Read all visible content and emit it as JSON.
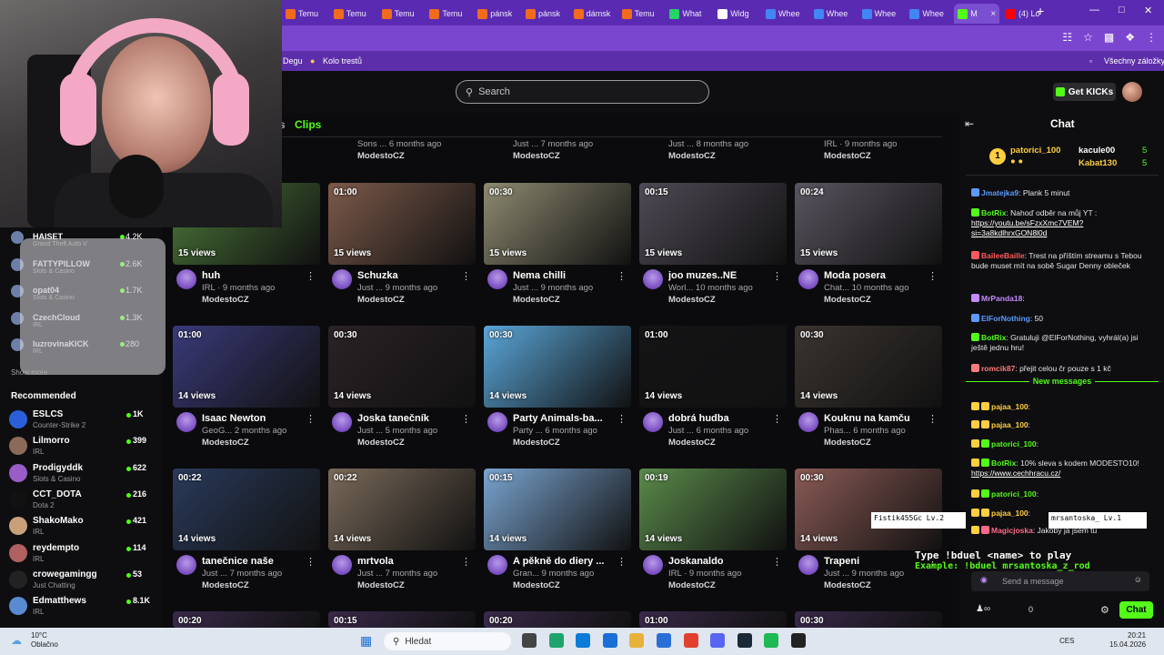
{
  "browser": {
    "tabs": [
      {
        "label": "Temu",
        "color": "#f26b1d"
      },
      {
        "label": "Temu",
        "color": "#f26b1d"
      },
      {
        "label": "Temu",
        "color": "#f26b1d"
      },
      {
        "label": "Temu",
        "color": "#f26b1d"
      },
      {
        "label": "pánsk",
        "color": "#f26b1d"
      },
      {
        "label": "pánsk",
        "color": "#f26b1d"
      },
      {
        "label": "dámsk",
        "color": "#f26b1d"
      },
      {
        "label": "Temu",
        "color": "#f26b1d"
      },
      {
        "label": "What",
        "color": "#25d366"
      },
      {
        "label": "Widg",
        "color": "#ffffff"
      },
      {
        "label": "Whee",
        "color": "#4285f4"
      },
      {
        "label": "Whee",
        "color": "#4285f4"
      },
      {
        "label": "Whee",
        "color": "#4285f4"
      },
      {
        "label": "Whee",
        "color": "#4285f4"
      },
      {
        "label": "M",
        "color": "#53fc18",
        "active": true
      },
      {
        "label": "(4) Lo",
        "color": "#ff0000"
      }
    ],
    "new_tab": "+",
    "bookmarks": [
      {
        "label": "Degu"
      },
      {
        "label": "Kolo trestů"
      }
    ],
    "all_bookmarks": "Všechny záložky"
  },
  "topnav": {
    "search_placeholder": "Search",
    "get_kicks": "Get KICKs"
  },
  "channel_tabs": {
    "prev_tab": "s",
    "active_tab": "Clips"
  },
  "following": [
    {
      "name": "HAISET",
      "sub": "Grand Theft Auto V",
      "count": "4.2K"
    },
    {
      "name": "FATTYPILLOW",
      "sub": "Slots & Casino",
      "count": "2.6K"
    },
    {
      "name": "opat04",
      "sub": "Slots & Casino",
      "count": "1.7K"
    },
    {
      "name": "CzechCloud",
      "sub": "IRL",
      "count": "1.3K"
    },
    {
      "name": "luzrovinaKICK",
      "sub": "IRL",
      "count": "280"
    }
  ],
  "show_more": "Show more",
  "recommended_title": "Recommended",
  "recommended": [
    {
      "name": "ESLCS",
      "category": "Counter-Strike 2",
      "count": "1K",
      "color": "#2b5fd9"
    },
    {
      "name": "Lilmorro",
      "category": "IRL",
      "count": "399",
      "color": "#8a6b5a"
    },
    {
      "name": "Prodigyddk",
      "category": "Slots & Casino",
      "count": "622",
      "color": "#9a5cc9"
    },
    {
      "name": "CCT_DOTA",
      "category": "Dota 2",
      "count": "216",
      "color": "#111111"
    },
    {
      "name": "ShakoMako",
      "category": "IRL",
      "count": "421",
      "color": "#c9a07a"
    },
    {
      "name": "reydempto",
      "category": "IRL",
      "count": "114",
      "color": "#b06060"
    },
    {
      "name": "crowegamingg",
      "category": "Just Chatting",
      "count": "53",
      "color": "#222222"
    },
    {
      "name": "Edmatthews",
      "category": "IRL",
      "count": "8.1K",
      "color": "#5a8ad0"
    }
  ],
  "top_partial": [
    {
      "meta": "Sons ... 6 months ago",
      "channel": "ModestoCZ"
    },
    {
      "meta": "Just ... 7 months ago",
      "channel": "ModestoCZ"
    },
    {
      "meta": "Just ... 8 months ago",
      "channel": "ModestoCZ"
    },
    {
      "meta": "IRL · 9 months ago",
      "channel": "ModestoCZ"
    }
  ],
  "clips": [
    {
      "duration": "",
      "views": "15 views",
      "title": "huh",
      "meta": "IRL · 9 months ago",
      "channel": "ModestoCZ",
      "tint": "#4c7a3a"
    },
    {
      "duration": "01:00",
      "views": "15 views",
      "title": "Schuzka",
      "meta": "Just ... 9 months ago",
      "channel": "ModestoCZ",
      "tint": "#7c5a4a"
    },
    {
      "duration": "00:30",
      "views": "15 views",
      "title": "Nema chilli",
      "meta": "Just ... 9 months ago",
      "channel": "ModestoCZ",
      "tint": "#8d8a70"
    },
    {
      "duration": "00:15",
      "views": "15 views",
      "title": "joo muzes..NE",
      "meta": "Worl... 10 months ago",
      "channel": "ModestoCZ",
      "tint": "#4f4a55"
    },
    {
      "duration": "00:24",
      "views": "15 views",
      "title": "Moda posera",
      "meta": "Chat... 10 months ago",
      "channel": "ModestoCZ",
      "tint": "#5a5560"
    },
    {
      "duration": "01:00",
      "views": "14 views",
      "title": "Isaac Newton",
      "meta": "GeoG... 2 months ago",
      "channel": "ModestoCZ",
      "tint": "#3a3a7a"
    },
    {
      "duration": "00:30",
      "views": "14 views",
      "title": "Joska tanečník",
      "meta": "Just ... 5 months ago",
      "channel": "ModestoCZ",
      "tint": "#2a2226"
    },
    {
      "duration": "00:30",
      "views": "14 views",
      "title": "Party Animals-ba...",
      "meta": "Party ... 6 months ago",
      "channel": "ModestoCZ",
      "tint": "#5aa6d8"
    },
    {
      "duration": "01:00",
      "views": "14 views",
      "title": "dobrá hudba",
      "meta": "Just ... 6 months ago",
      "channel": "ModestoCZ",
      "tint": "#141416"
    },
    {
      "duration": "00:30",
      "views": "14 views",
      "title": "Kouknu na kamču",
      "meta": "Phas... 6 months ago",
      "channel": "ModestoCZ",
      "tint": "#3a3430"
    },
    {
      "duration": "00:22",
      "views": "14 views",
      "title": "tanečnice naše",
      "meta": "Just ... 7 months ago",
      "channel": "ModestoCZ",
      "tint": "#2a3a5a"
    },
    {
      "duration": "00:22",
      "views": "14 views",
      "title": "mrtvola",
      "meta": "Just ... 7 months ago",
      "channel": "ModestoCZ",
      "tint": "#7a6a5a"
    },
    {
      "duration": "00:15",
      "views": "14 views",
      "title": "A pěkně do diery ...",
      "meta": "Gran... 9 months ago",
      "channel": "ModestoCZ",
      "tint": "#7aa4d0"
    },
    {
      "duration": "00:19",
      "views": "14 views",
      "title": "Joskanaldo",
      "meta": "IRL · 9 months ago",
      "channel": "ModestoCZ",
      "tint": "#5a8a4a"
    },
    {
      "duration": "00:30",
      "views": "14 views",
      "title": "Trapeni",
      "meta": "Just ... 9 months ago",
      "channel": "ModestoCZ",
      "tint": "#8a5a55"
    }
  ],
  "bottom_durations": [
    "00:20",
    "00:15",
    "00:20",
    "01:00",
    "00:30"
  ],
  "chat": {
    "title": "Chat",
    "pinned": [
      {
        "name": "patorici_100",
        "rank": "1",
        "count": "5"
      },
      {
        "name": "kacule00",
        "count": "5"
      },
      {
        "name": "Kabat130",
        "count": "5"
      }
    ],
    "messages": [
      {
        "user": "Jmatejka9",
        "color": "#5b9bff",
        "text": ": Plank 5 minut"
      },
      {
        "user": "BotRix",
        "color": "#53fc18",
        "text": ": Nahoď odběr na můj YT :",
        "link": "https://youtu.be/sFzxXmc7VEM?si=3a8kdlhrxGON8l0d"
      },
      {
        "user": "BaileeBaille",
        "color": "#ff5a5a",
        "text": ": Trest na příštím streamu s Tebou bude muset mít na sobě Sugar Denny obleček"
      },
      {
        "user": "MrPanda18",
        "color": "#c48cff",
        "text": ":"
      },
      {
        "user": "ElForNothing",
        "color": "#5b9bff",
        "text": ": 50"
      },
      {
        "user": "BotRix",
        "color": "#53fc18",
        "text": ": Gratuluji @ElForNothing, vyhrál(a) jsi ještě jednu hru!"
      },
      {
        "user": "romcik87",
        "color": "#ff7a7a",
        "text": ": přejit celou čr pouze s 1 kč"
      }
    ],
    "new_messages_label": "New messages",
    "new_messages": [
      {
        "user": "pajaa_100",
        "color": "#ffcf40",
        "text": ":"
      },
      {
        "user": "pajaa_100",
        "color": "#ffcf40",
        "text": ":"
      },
      {
        "user": "patorici_100",
        "color": "#53fc18",
        "text": ":"
      },
      {
        "user": "BotRix",
        "color": "#53fc18",
        "text": ": 10% sleva s kodem MODESTO10!",
        "link": "https://www.cechhracu.cz/"
      },
      {
        "user": "patorici_100",
        "color": "#53fc18",
        "text": ":"
      },
      {
        "user": "pajaa_100",
        "color": "#ffcf40",
        "text": ":"
      },
      {
        "user": "Magicjoska",
        "color": "#ff6a8a",
        "text": ": Jakoby ja jsem tu"
      }
    ],
    "send_placeholder": "Send a message",
    "chat_button": "Chat",
    "overlay_line1": "Type !bduel <name> to play",
    "overlay_line2": "Example: !bduel mrsantoska_z_rod",
    "duel_left": "Fistik455Gc Lv.2",
    "duel_right": "mrsantoska_ Lv.1",
    "count": "0"
  },
  "taskbar": {
    "weather_temp": "10°C",
    "weather_desc": "Oblačno",
    "search": "Hledat",
    "lang": "CES",
    "time": "20:21",
    "date": "15.04.2026"
  }
}
